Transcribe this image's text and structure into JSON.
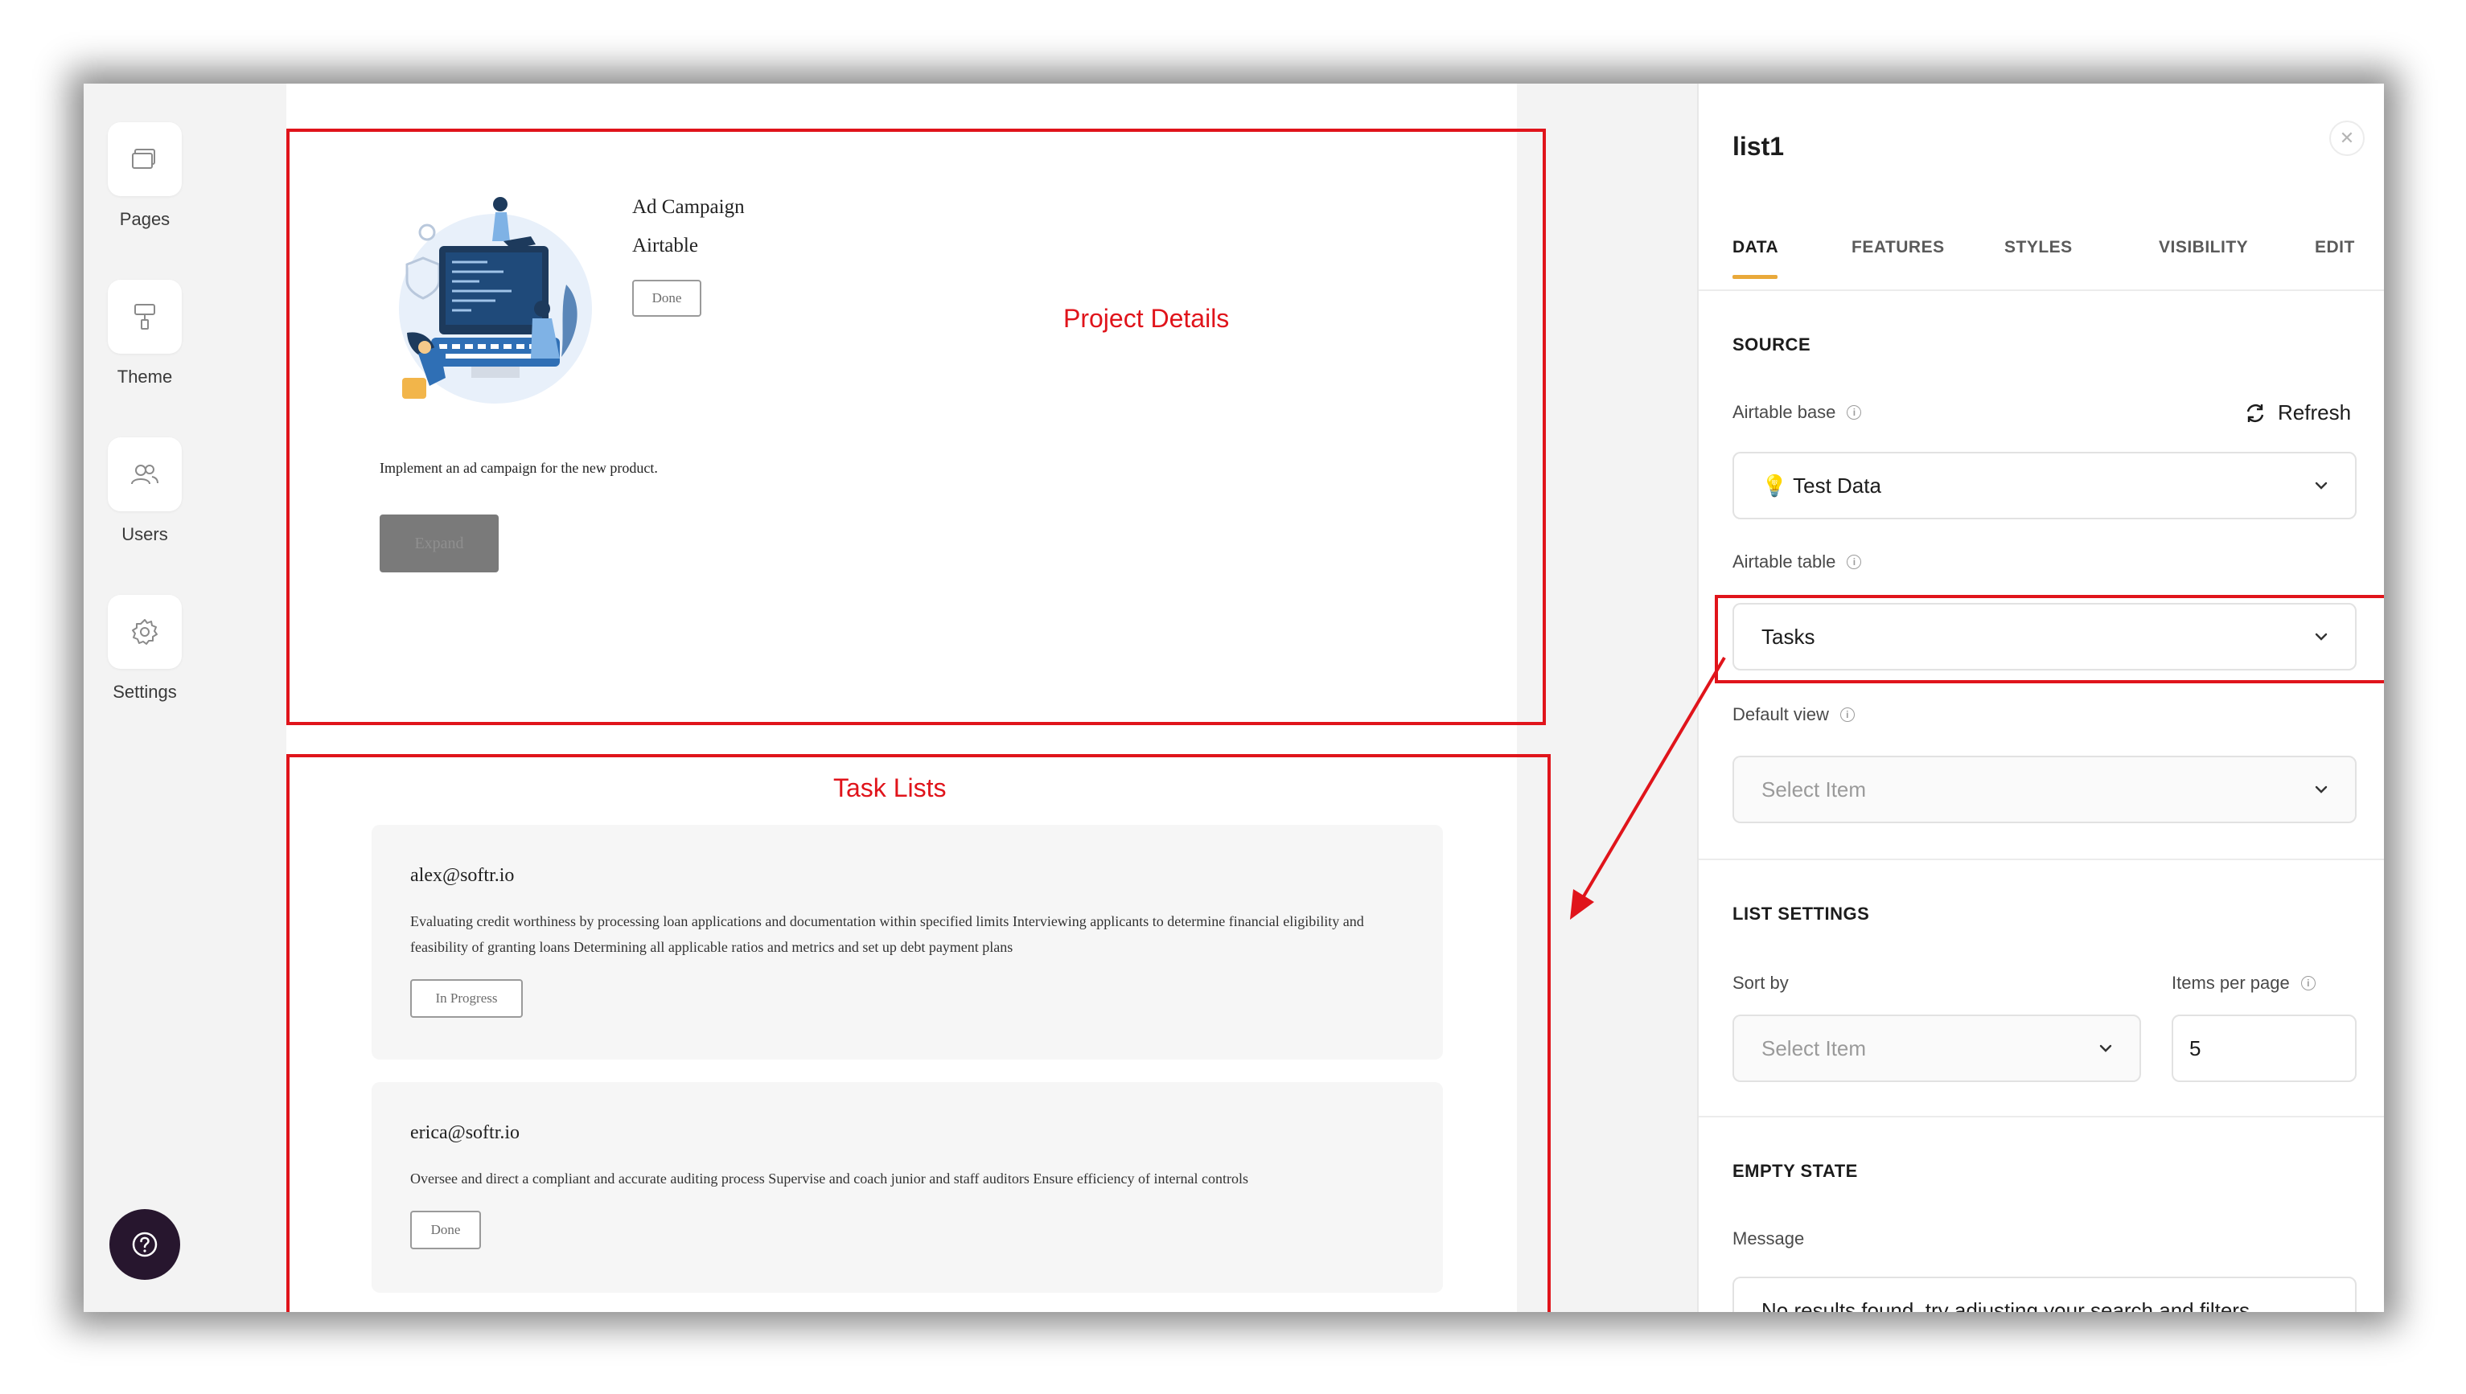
{
  "sidebar": {
    "items": [
      {
        "label": "Pages",
        "icon": "pages-icon"
      },
      {
        "label": "Theme",
        "icon": "paint-roller-icon"
      },
      {
        "label": "Users",
        "icon": "users-icon"
      },
      {
        "label": "Settings",
        "icon": "gear-icon"
      }
    ],
    "help_icon": "question-circle-icon"
  },
  "project": {
    "title": "Ad Campaign",
    "source": "Airtable",
    "status": "Done",
    "description": "Implement an ad campaign for the new product.",
    "expand_label": "Expand"
  },
  "annotations": {
    "project_details": "Project Details",
    "task_lists": "Task Lists",
    "color": "#e0141b"
  },
  "tasks": [
    {
      "email": "alex@softr.io",
      "description": "Evaluating credit worthiness by processing loan applications and documentation within specified limits Interviewing applicants to determine financial eligibility and feasibility of granting loans Determining all applicable ratios and metrics and set up debt payment plans",
      "status": "In Progress"
    },
    {
      "email": "erica@softr.io",
      "description": "Oversee and direct a compliant and accurate auditing process Supervise and coach junior and staff auditors Ensure efficiency of internal controls",
      "status": "Done"
    }
  ],
  "panel": {
    "title": "list1",
    "close_icon": "close-icon",
    "tabs": [
      {
        "label": "DATA",
        "active": true
      },
      {
        "label": "FEATURES",
        "active": false
      },
      {
        "label": "STYLES",
        "active": false
      },
      {
        "label": "VISIBILITY",
        "active": false
      },
      {
        "label": "EDIT",
        "active": false
      }
    ],
    "accent": "#e9a93a",
    "source": {
      "title": "SOURCE",
      "base_label": "Airtable base",
      "refresh_label": "Refresh",
      "base_value": "💡 Test Data",
      "table_label": "Airtable table",
      "table_value": "Tasks",
      "view_label": "Default view",
      "view_placeholder": "Select Item"
    },
    "list_settings": {
      "title": "LIST SETTINGS",
      "sort_label": "Sort by",
      "sort_placeholder": "Select Item",
      "items_label": "Items per page",
      "items_value": "5"
    },
    "empty_state": {
      "title": "EMPTY STATE",
      "message_label": "Message",
      "message_value": "No results found, try adjusting your search and filters."
    }
  }
}
